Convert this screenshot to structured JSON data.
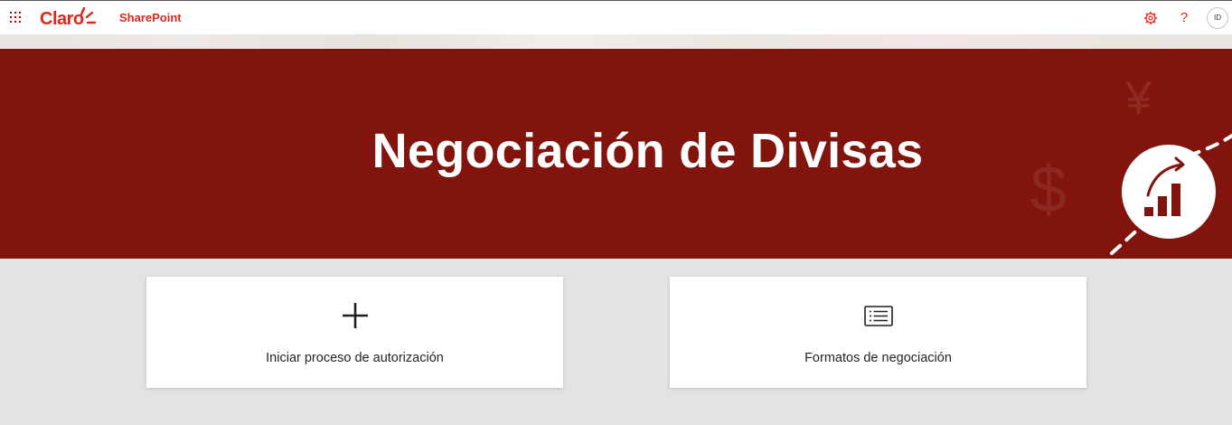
{
  "suite_bar": {
    "logo_text": "Claro",
    "app_name": "SharePoint",
    "help_glyph": "?",
    "avatar_initials": "ID",
    "icons": [
      "app-launcher-icon",
      "gear-icon",
      "help-icon"
    ]
  },
  "hero": {
    "title": "Negociación de Divisas",
    "decor_symbols": [
      "¥",
      "$"
    ],
    "background_color": "#81150e"
  },
  "cards": [
    {
      "label": "Iniciar proceso de autorización",
      "icon": "plus-icon"
    },
    {
      "label": "Formatos de negociación",
      "icon": "list-document-icon"
    }
  ],
  "colors": {
    "brand_red": "#e1261c",
    "hero_red": "#81150e",
    "page_bg": "#e3e3e3"
  }
}
